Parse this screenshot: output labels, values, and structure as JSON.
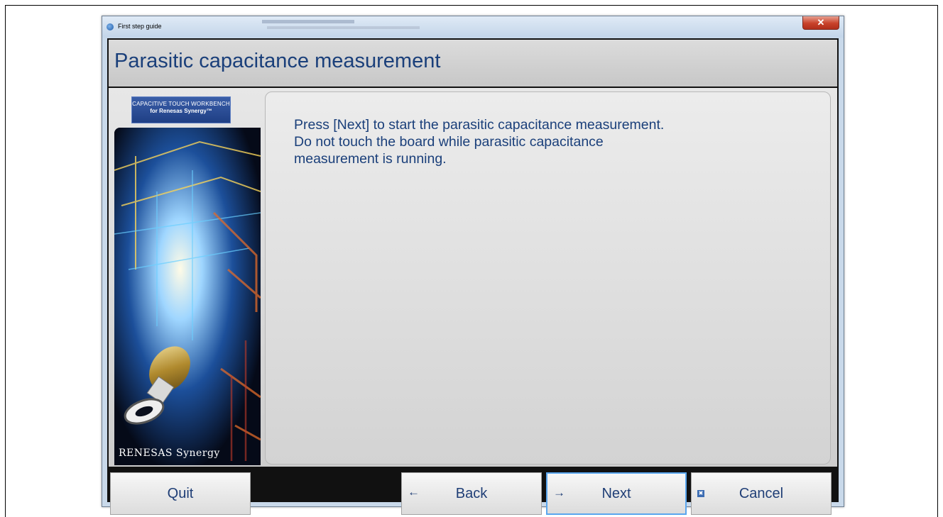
{
  "window": {
    "title": "First step guide",
    "close_glyph": "✕"
  },
  "page": {
    "title": "Parasitic capacitance measurement",
    "instruction": "Press [Next] to start the parasitic capacitance measurement.\nDo not touch the board while parasitic capacitance\nmeasurement is running."
  },
  "sidebar": {
    "product_line1": "CAPACITIVE TOUCH WORKBENCH",
    "product_line2": "for Renesas Synergy™",
    "brand": "RENESAS Synergy"
  },
  "buttons": {
    "quit": "Quit",
    "back": "Back",
    "back_icon": "←",
    "next": "Next",
    "next_icon": "→",
    "cancel": "Cancel",
    "cancel_icon": "✖"
  },
  "colors": {
    "title_text": "#1a3f7a",
    "accent_focus": "#5aa6ee",
    "close_button": "#c8412a"
  }
}
